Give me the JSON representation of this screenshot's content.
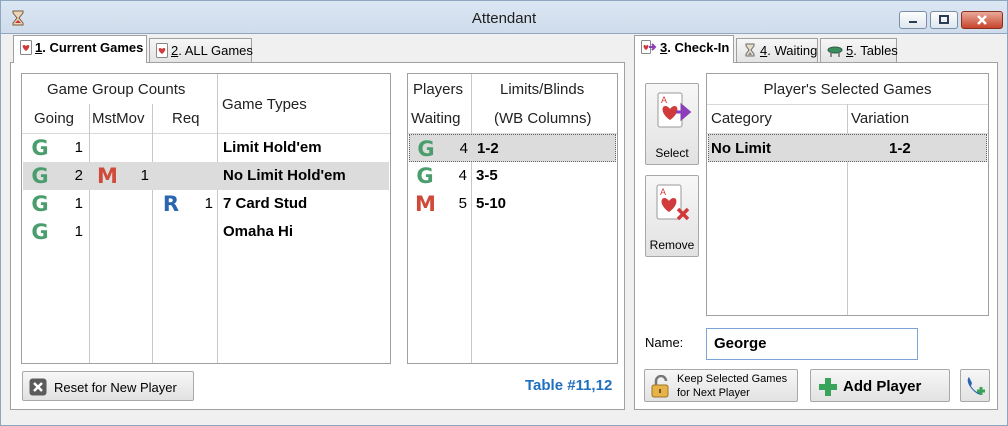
{
  "window": {
    "title": "Attendant"
  },
  "left_tabs": [
    {
      "num": "1",
      "label": ". Current Games"
    },
    {
      "num": "2",
      "label": ". ALL Games"
    }
  ],
  "right_tabs": [
    {
      "num": "3",
      "label": ". Check-In"
    },
    {
      "num": "4",
      "label": ". Waiting"
    },
    {
      "num": "5",
      "label": ". Tables"
    }
  ],
  "game_groups": {
    "header_group": "Game Group Counts",
    "col_going": "Going",
    "col_mstmov": "MstMov",
    "col_req": "Req",
    "col_types": "Game Types",
    "rows": [
      {
        "going_badge": "G",
        "going": "1",
        "mst_badge": "",
        "mst": "",
        "req_badge": "",
        "req": "",
        "type": "Limit Hold'em",
        "selected": false
      },
      {
        "going_badge": "G",
        "going": "2",
        "mst_badge": "M",
        "mst": "1",
        "req_badge": "",
        "req": "",
        "type": "No Limit Hold'em",
        "selected": true
      },
      {
        "going_badge": "G",
        "going": "1",
        "mst_badge": "",
        "mst": "",
        "req_badge": "R",
        "req": "1",
        "type": "7 Card Stud",
        "selected": false
      },
      {
        "going_badge": "G",
        "going": "1",
        "mst_badge": "",
        "mst": "",
        "req_badge": "",
        "req": "",
        "type": "Omaha Hi",
        "selected": false
      }
    ]
  },
  "limits": {
    "col_players_1": "Players",
    "col_players_2": "Waiting",
    "col_limits_1": "Limits/Blinds",
    "col_limits_2": "(WB Columns)",
    "rows": [
      {
        "badge": "G",
        "count": "4",
        "limit": "1-2",
        "selected": true
      },
      {
        "badge": "G",
        "count": "4",
        "limit": "3-5",
        "selected": false
      },
      {
        "badge": "M",
        "count": "5",
        "limit": "5-10",
        "selected": false
      }
    ]
  },
  "reset_button": {
    "label": "Reset for New Player"
  },
  "table_label": "Table #11,12",
  "select_button": {
    "label": "Select"
  },
  "remove_button": {
    "label": "Remove"
  },
  "selected_games": {
    "title": "Player's Selected Games",
    "col_category": "Category",
    "col_variation": "Variation",
    "rows": [
      {
        "category": "No Limit",
        "variation": "1-2"
      }
    ]
  },
  "name_field": {
    "label": "Name:",
    "value": "George"
  },
  "keep_button": {
    "line1": "Keep Selected Games",
    "line2": "for Next Player"
  },
  "add_player_button": {
    "label": "Add Player"
  },
  "colors": {
    "green": "#4a9e6e",
    "red": "#d04a3a",
    "blue": "#2a66b0",
    "table_label": "#1f6fc0"
  }
}
